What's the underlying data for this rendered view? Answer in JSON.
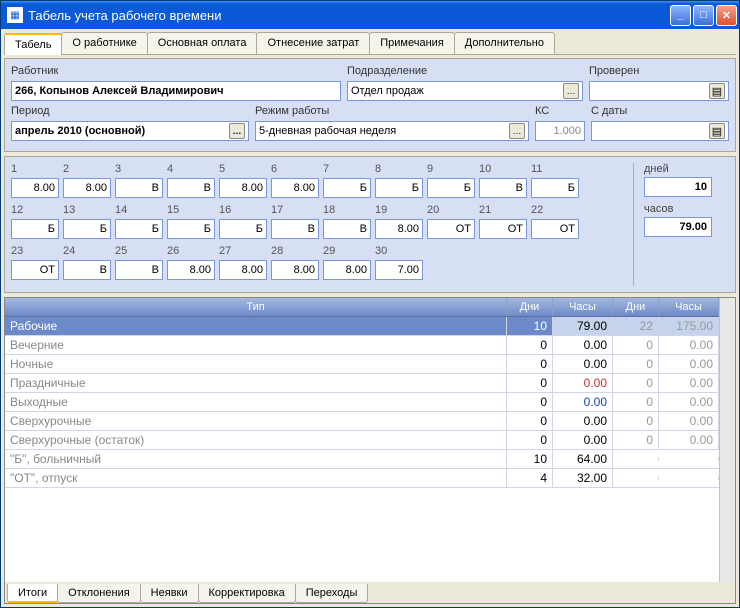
{
  "window": {
    "title": "Табель учета рабочего времени"
  },
  "tabs_top": [
    "Табель",
    "О работнике",
    "Основная оплата",
    "Отнесение затрат",
    "Примечания",
    "Дополнительно"
  ],
  "active_tab_top": 0,
  "header": {
    "worker_label": "Работник",
    "worker_value": "266, Копынов Алексей Владимирович",
    "dept_label": "Подразделение",
    "dept_value": "Отдел продаж",
    "checked_label": "Проверен",
    "checked_value": "",
    "period_label": "Период",
    "period_value": "апрель 2010 (основной)",
    "mode_label": "Режим работы",
    "mode_value": "5-дневная рабочая неделя",
    "ks_label": "КС",
    "ks_value": "1.000",
    "from_date_label": "С даты",
    "from_date_value": ""
  },
  "days": [
    {
      "n": "1",
      "v": "8.00"
    },
    {
      "n": "2",
      "v": "8.00"
    },
    {
      "n": "3",
      "v": "В"
    },
    {
      "n": "4",
      "v": "В"
    },
    {
      "n": "5",
      "v": "8.00"
    },
    {
      "n": "6",
      "v": "8.00"
    },
    {
      "n": "7",
      "v": "Б"
    },
    {
      "n": "8",
      "v": "Б"
    },
    {
      "n": "9",
      "v": "Б"
    },
    {
      "n": "10",
      "v": "В"
    },
    {
      "n": "11",
      "v": "Б"
    },
    {
      "n": "12",
      "v": "Б"
    },
    {
      "n": "13",
      "v": "Б"
    },
    {
      "n": "14",
      "v": "Б"
    },
    {
      "n": "15",
      "v": "Б"
    },
    {
      "n": "16",
      "v": "Б"
    },
    {
      "n": "17",
      "v": "В"
    },
    {
      "n": "18",
      "v": "В"
    },
    {
      "n": "19",
      "v": "8.00"
    },
    {
      "n": "20",
      "v": "ОТ"
    },
    {
      "n": "21",
      "v": "ОТ"
    },
    {
      "n": "22",
      "v": "ОТ"
    },
    {
      "n": "23",
      "v": "ОТ"
    },
    {
      "n": "24",
      "v": "В"
    },
    {
      "n": "25",
      "v": "В"
    },
    {
      "n": "26",
      "v": "8.00"
    },
    {
      "n": "27",
      "v": "8.00"
    },
    {
      "n": "28",
      "v": "8.00"
    },
    {
      "n": "29",
      "v": "8.00"
    },
    {
      "n": "30",
      "v": "7.00"
    }
  ],
  "totals": {
    "days_label": "дней",
    "days_value": "10",
    "hours_label": "часов",
    "hours_value": "79.00"
  },
  "table": {
    "headers": [
      "Тип",
      "Дни",
      "Часы",
      "Дни",
      "Часы"
    ],
    "rows": [
      {
        "type": "Рабочие",
        "d1": "10",
        "h1": "79.00",
        "d2": "22",
        "h2": "175.00",
        "sel": true,
        "h1_color": ""
      },
      {
        "type": "Вечерние",
        "d1": "0",
        "h1": "0.00",
        "d2": "0",
        "h2": "0.00"
      },
      {
        "type": "Ночные",
        "d1": "0",
        "h1": "0.00",
        "d2": "0",
        "h2": "0.00"
      },
      {
        "type": "Праздничные",
        "d1": "0",
        "h1": "0.00",
        "d2": "0",
        "h2": "0.00",
        "h1_color": "#c03030"
      },
      {
        "type": "Выходные",
        "d1": "0",
        "h1": "0.00",
        "d2": "0",
        "h2": "0.00",
        "h1_color": "#1040b0"
      },
      {
        "type": "Сверхурочные",
        "d1": "0",
        "h1": "0.00",
        "d2": "0",
        "h2": "0.00"
      },
      {
        "type": "Сверхурочные (остаток)",
        "d1": "0",
        "h1": "0.00",
        "d2": "0",
        "h2": "0.00"
      },
      {
        "type": "\"Б\", больничный",
        "d1": "10",
        "h1": "64.00",
        "d2": "",
        "h2": ""
      },
      {
        "type": "\"ОТ\", отпуск",
        "d1": "4",
        "h1": "32.00",
        "d2": "",
        "h2": ""
      }
    ]
  },
  "tabs_bottom": [
    "Итоги",
    "Отклонения",
    "Неявки",
    "Корректировка",
    "Переходы"
  ],
  "active_tab_bottom": 0
}
